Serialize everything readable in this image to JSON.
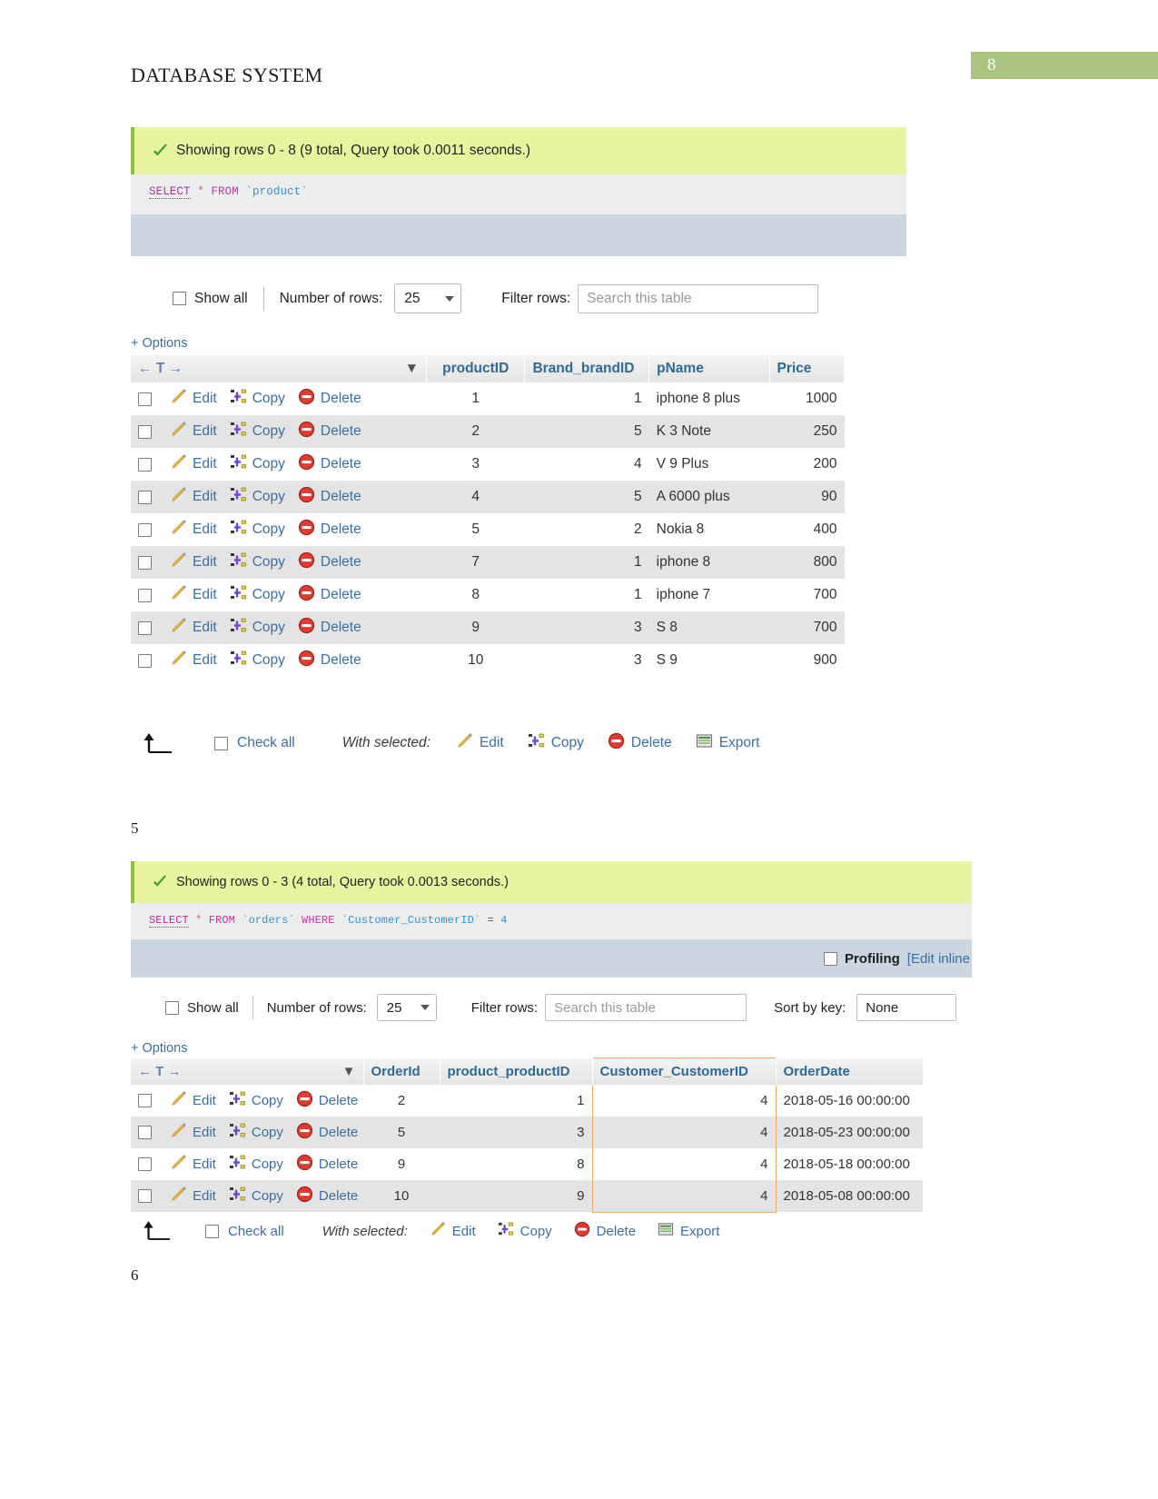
{
  "document": {
    "title": "DATABASE SYSTEM",
    "page_number": "8",
    "page_badge_color": "#a9c47f",
    "caption_between": "5",
    "caption_bottom": "6"
  },
  "result_one": {
    "status": "Showing rows 0 - 8 (9 total, Query took 0.0011 seconds.)",
    "sql": {
      "select": "SELECT",
      "star": "*",
      "from": "FROM",
      "table": "`product`"
    },
    "toolbar": {
      "show_all": "Show all",
      "number_of_rows_label": "Number of rows:",
      "number_of_rows_value": "25",
      "filter_rows_label": "Filter rows:",
      "filter_placeholder": "Search this table",
      "options": "+ Options"
    },
    "columns": [
      "productID",
      "Brand_brandID",
      "pName",
      "Price"
    ],
    "actions": {
      "edit": "Edit",
      "copy": "Copy",
      "delete": "Delete"
    },
    "rows": [
      {
        "productID": "1",
        "brand": "1",
        "pName": "iphone 8 plus",
        "price": "1000"
      },
      {
        "productID": "2",
        "brand": "5",
        "pName": "K 3 Note",
        "price": "250"
      },
      {
        "productID": "3",
        "brand": "4",
        "pName": "V 9 Plus",
        "price": "200"
      },
      {
        "productID": "4",
        "brand": "5",
        "pName": "A 6000 plus",
        "price": "90"
      },
      {
        "productID": "5",
        "brand": "2",
        "pName": "Nokia 8",
        "price": "400"
      },
      {
        "productID": "7",
        "brand": "1",
        "pName": "iphone 8",
        "price": "800"
      },
      {
        "productID": "8",
        "brand": "1",
        "pName": "iphone 7",
        "price": "700"
      },
      {
        "productID": "9",
        "brand": "3",
        "pName": "S 8",
        "price": "700"
      },
      {
        "productID": "10",
        "brand": "3",
        "pName": "S 9",
        "price": "900"
      }
    ],
    "footer": {
      "check_all": "Check all",
      "with_selected": "With selected:",
      "edit": "Edit",
      "copy": "Copy",
      "delete": "Delete",
      "export": "Export"
    }
  },
  "result_two": {
    "status": "Showing rows 0 - 3 (4 total, Query took 0.0013 seconds.)",
    "sql": {
      "select": "SELECT",
      "star": "*",
      "from": "FROM",
      "table": "`orders`",
      "where": "WHERE",
      "column": "`Customer_CustomerID`",
      "eq": "=",
      "value": "4"
    },
    "profiling": {
      "label": "Profiling",
      "edit_inline": "[Edit inline"
    },
    "toolbar": {
      "show_all": "Show all",
      "number_of_rows_label": "Number of rows:",
      "number_of_rows_value": "25",
      "filter_rows_label": "Filter rows:",
      "filter_placeholder": "Search this table",
      "sort_by_key_label": "Sort by key:",
      "sort_by_key_value": "None",
      "options": "+ Options"
    },
    "columns": [
      "OrderId",
      "product_productID",
      "Customer_CustomerID",
      "OrderDate"
    ],
    "highlight_column": "Customer_CustomerID",
    "highlight_color": "#f0a868",
    "actions": {
      "edit": "Edit",
      "copy": "Copy",
      "delete": "Delete"
    },
    "rows": [
      {
        "orderId": "2",
        "product": "1",
        "customer": "4",
        "orderDate": "2018-05-16 00:00:00"
      },
      {
        "orderId": "5",
        "product": "3",
        "customer": "4",
        "orderDate": "2018-05-23 00:00:00"
      },
      {
        "orderId": "9",
        "product": "8",
        "customer": "4",
        "orderDate": "2018-05-18 00:00:00"
      },
      {
        "orderId": "10",
        "product": "9",
        "customer": "4",
        "orderDate": "2018-05-08 00:00:00"
      }
    ],
    "footer": {
      "check_all": "Check all",
      "with_selected": "With selected:",
      "edit": "Edit",
      "copy": "Copy",
      "delete": "Delete",
      "export": "Export"
    }
  }
}
